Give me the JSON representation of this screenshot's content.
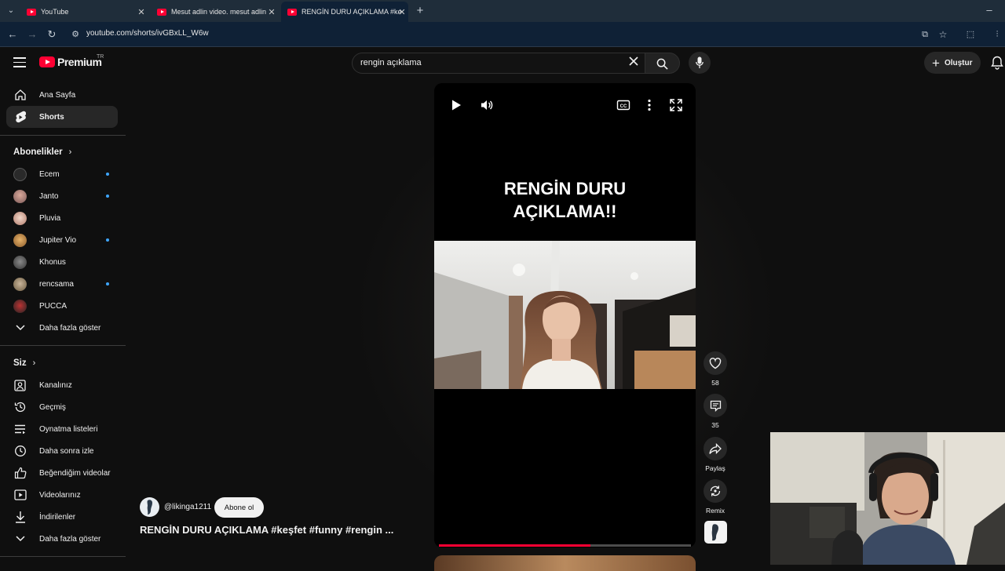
{
  "browser": {
    "tabs": [
      {
        "title": "YouTube",
        "active": false
      },
      {
        "title": "Mesut adlin video. mesut adlin",
        "active": false
      },
      {
        "title": "RENGİN DURU AÇIKLAMA #keşfet",
        "active": true
      }
    ],
    "new_tab": "+",
    "url": "youtube.com/shorts/ivGBxLL_W6w"
  },
  "header": {
    "logo_text": "Premium",
    "country_code": "TR",
    "search_value": "rengin açıklama",
    "create_label": "Oluştur",
    "colors": {
      "brand": "#ff0033",
      "background": "#0f0f0f"
    }
  },
  "sidebar": {
    "main": [
      {
        "label": "Ana Sayfa",
        "icon": "home-icon"
      },
      {
        "label": "Shorts",
        "icon": "shorts-icon",
        "active": true
      }
    ],
    "subscriptions_title": "Abonelikler",
    "subscriptions": [
      {
        "label": "Ecem",
        "new": true
      },
      {
        "label": "Janto",
        "new": true
      },
      {
        "label": "Pluvia",
        "new": false
      },
      {
        "label": "Jupiter Vio",
        "new": true
      },
      {
        "label": "Khonus",
        "new": false
      },
      {
        "label": "rencsama",
        "new": true
      },
      {
        "label": "PUCCA",
        "new": false
      }
    ],
    "show_more": "Daha fazla göster",
    "you_title": "Siz",
    "you": [
      {
        "label": "Kanalınız",
        "icon": "channel-icon"
      },
      {
        "label": "Geçmiş",
        "icon": "history-icon"
      },
      {
        "label": "Oynatma listeleri",
        "icon": "playlists-icon"
      },
      {
        "label": "Daha sonra izle",
        "icon": "watch-later-icon"
      },
      {
        "label": "Beğendiğim videolar",
        "icon": "thumbs-up-icon"
      },
      {
        "label": "Videolarınız",
        "icon": "your-videos-icon"
      },
      {
        "label": "İndirilenler",
        "icon": "download-icon"
      }
    ],
    "show_more_2": "Daha fazla göster"
  },
  "short": {
    "overlay_title_line1": "RENGİN DURU",
    "overlay_title_line2": "AÇIKLAMA!!",
    "progress": 0.6,
    "likes": "58",
    "comments": "35",
    "share_label": "Paylaş",
    "remix_label": "Remix",
    "channel_handle": "@likinga1211",
    "subscribe_label": "Abone ol",
    "caption": "RENGİN DURU AÇIKLAMA #keşfet #funny #rengin ..."
  }
}
